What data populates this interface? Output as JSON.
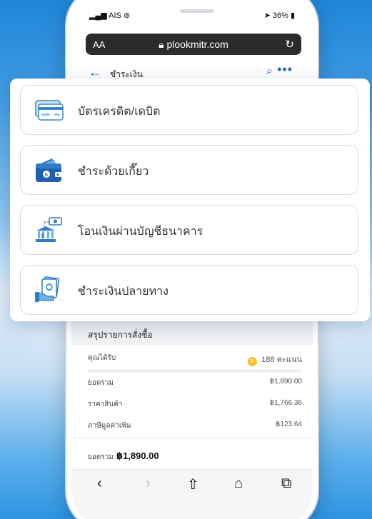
{
  "status_bar": {
    "carrier": "AIS",
    "battery": "36%"
  },
  "browser": {
    "text_size_label": "AA",
    "url": "plookmitr.com"
  },
  "page": {
    "back": "←",
    "title": "ชำระเงิน",
    "more": "•••"
  },
  "payment_options": [
    {
      "label": "บัตรเครดิต/เดบิต",
      "icon": "credit-card-icon"
    },
    {
      "label": "ชำระด้วยเกี๊ยว",
      "icon": "wallet-icon"
    },
    {
      "label": "โอนเงินผ่านบัญชีธนาคาร",
      "icon": "bank-transfer-icon"
    },
    {
      "label": "ชำระเงินปลายทาง",
      "icon": "cash-on-delivery-icon"
    }
  ],
  "summary": {
    "heading": "สรุปรายการสั่งซื้อ",
    "points_label": "คุณได้รับ",
    "points_value": "188 คะแนน",
    "grand_label": "ยอดรวม",
    "grand_value": "฿1,890.00",
    "product_label": "ราคาสินค้า",
    "product_value": "฿1,766.36",
    "vat_label": "ภาษีมูลค่าเพิ่ม",
    "vat_value": "฿123.64",
    "footer_label": "ยอดรวม",
    "footer_value": "฿1,890.00"
  },
  "toolbar": {
    "back": "‹",
    "forward": "›",
    "share": "⇧",
    "bookmarks": "⌂",
    "tabs": "⧉"
  },
  "colors": {
    "accent": "#2a64c8",
    "coin": "#f6c12a"
  }
}
